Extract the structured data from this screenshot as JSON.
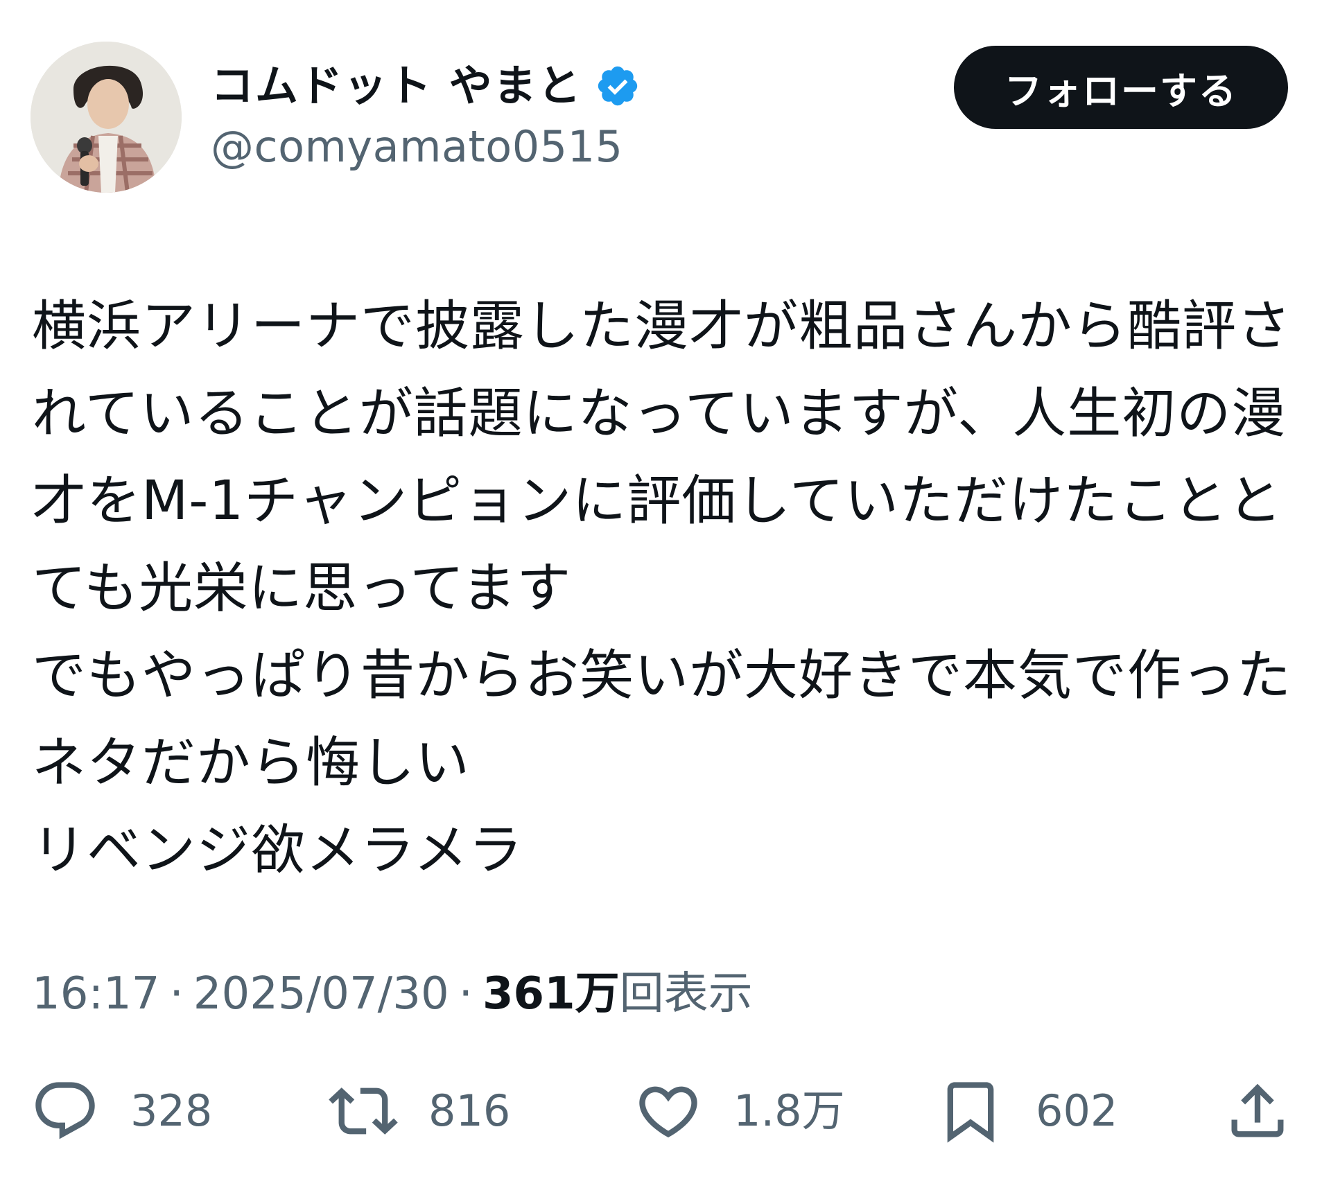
{
  "author": {
    "display_name": "コムドット やまと",
    "handle": "@comyamato0515",
    "verified_icon": "verified-badge-icon",
    "avatar_icon": "avatar-photo"
  },
  "follow_button": {
    "label": "フォローする"
  },
  "body": {
    "lines": [
      "横浜アリーナで披露した漫才が粗品さんから酷評さ",
      "れていることが話題になっていますが、人生初の漫",
      "才をM-1チャンピョンに評価していただけたことと",
      "ても光栄に思ってます",
      "でもやっぱり昔からお笑いが大好きで本気で作った",
      "ネタだから悔しい",
      "リベンジ欲メラメラ"
    ]
  },
  "meta": {
    "time": "16:17",
    "separator": "·",
    "date": "2025/07/30",
    "views_count": "361万",
    "views_label": "回表示"
  },
  "actions": {
    "reply": {
      "icon": "reply-icon",
      "count": "328"
    },
    "retweet": {
      "icon": "retweet-icon",
      "count": "816"
    },
    "like": {
      "icon": "heart-icon",
      "count": "1.8万"
    },
    "bookmark": {
      "icon": "bookmark-icon",
      "count": "602"
    },
    "share": {
      "icon": "share-icon"
    }
  },
  "colors": {
    "text_primary": "#0f1419",
    "text_secondary": "#536471",
    "verified_blue": "#1d9bf0",
    "button_bg": "#0f1419"
  }
}
